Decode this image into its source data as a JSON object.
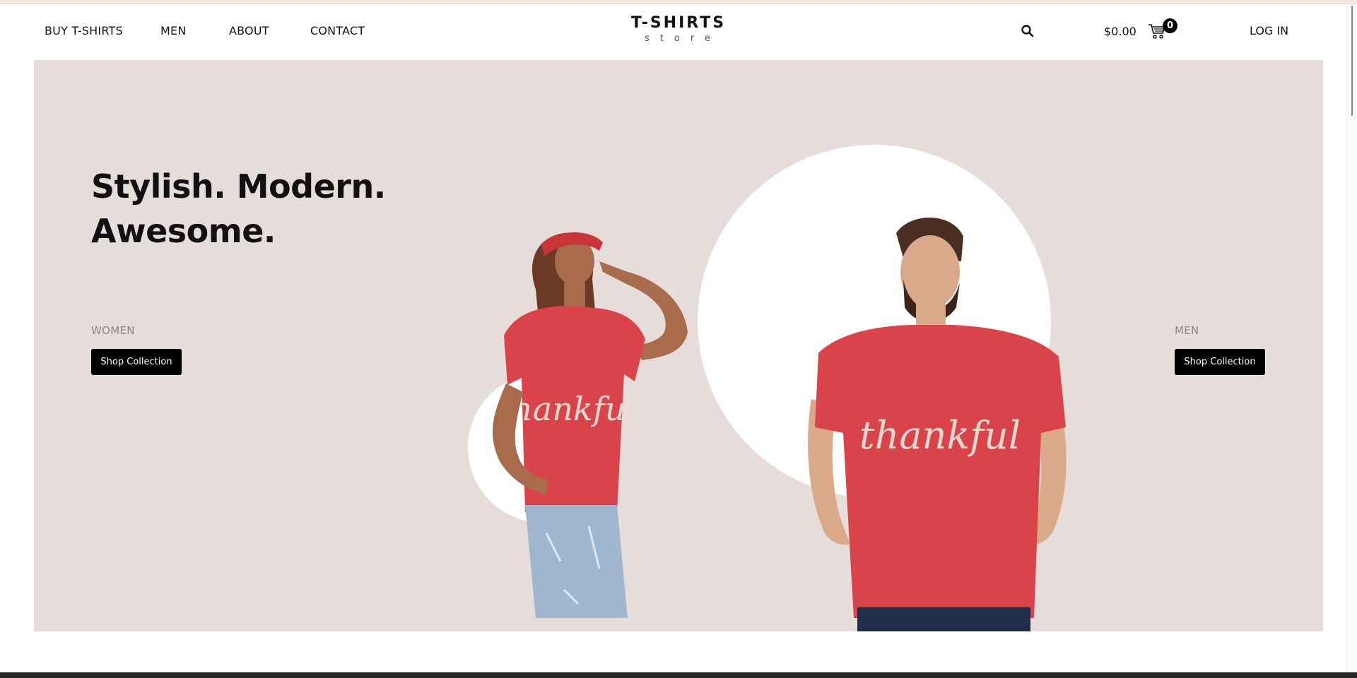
{
  "nav": {
    "buy_tshirts": "BUY T-SHIRTS",
    "men": "MEN",
    "about": "ABOUT",
    "contact": "CONTACT"
  },
  "logo": {
    "main": "T-SHIRTS",
    "sub": "store"
  },
  "header_right": {
    "search_icon": "search-icon",
    "cart_total": "$0.00",
    "cart_icon": "cart-icon",
    "cart_count": "0",
    "login": "LOG IN"
  },
  "hero": {
    "title_line1": "Stylish. Modern.",
    "title_line2": "Awesome.",
    "women_label": "WOMEN",
    "women_button": "Shop Collection",
    "men_label": "MEN",
    "men_button": "Shop Collection",
    "shirt_text": "thankful"
  },
  "colors": {
    "hero_bg": "#e6dcda",
    "button_bg": "#000000",
    "shirt_red": "#d8444a"
  }
}
